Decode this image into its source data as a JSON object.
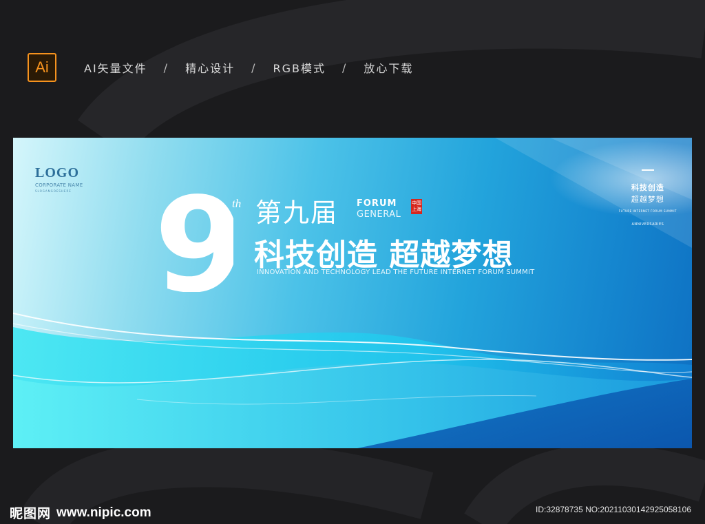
{
  "header": {
    "ai_badge": "Ai",
    "features": [
      "AI矢量文件",
      "精心设计",
      "RGB模式",
      "放心下载"
    ],
    "separator": "/"
  },
  "banner": {
    "logo": {
      "text": "LOGO",
      "subtitle": "CORPORATE NAME",
      "tagline": "SLOGANGOESHERE"
    },
    "ordinal": "9",
    "ordinal_suffix": "th",
    "edition": "第九届",
    "forum_line1": "FORUM",
    "forum_line2": "GENERAL",
    "seal": [
      "中国",
      "上海"
    ],
    "slogan": "科技创造 超越梦想",
    "subtitle": "INNOVATION AND TECHNOLOGY LEAD THE FUTURE INTERNET FORUM SUMMIT",
    "side": {
      "line1": "科技创造",
      "line2": "超越梦想",
      "line3": "FUTURE INTERNET FORUM SUMMIT",
      "line4": "ANNIVERSARIES"
    }
  },
  "footer": {
    "site_name": "昵图网",
    "site_url": "www.nipic.com",
    "image_id": "ID:32878735 NO:20211030142925058106"
  },
  "colors": {
    "background": "#1b1b1d",
    "ai_orange": "#f7931e",
    "banner_light": "#d5f6fb",
    "banner_dark": "#0e6fc2",
    "seal_red": "#d6271e"
  }
}
